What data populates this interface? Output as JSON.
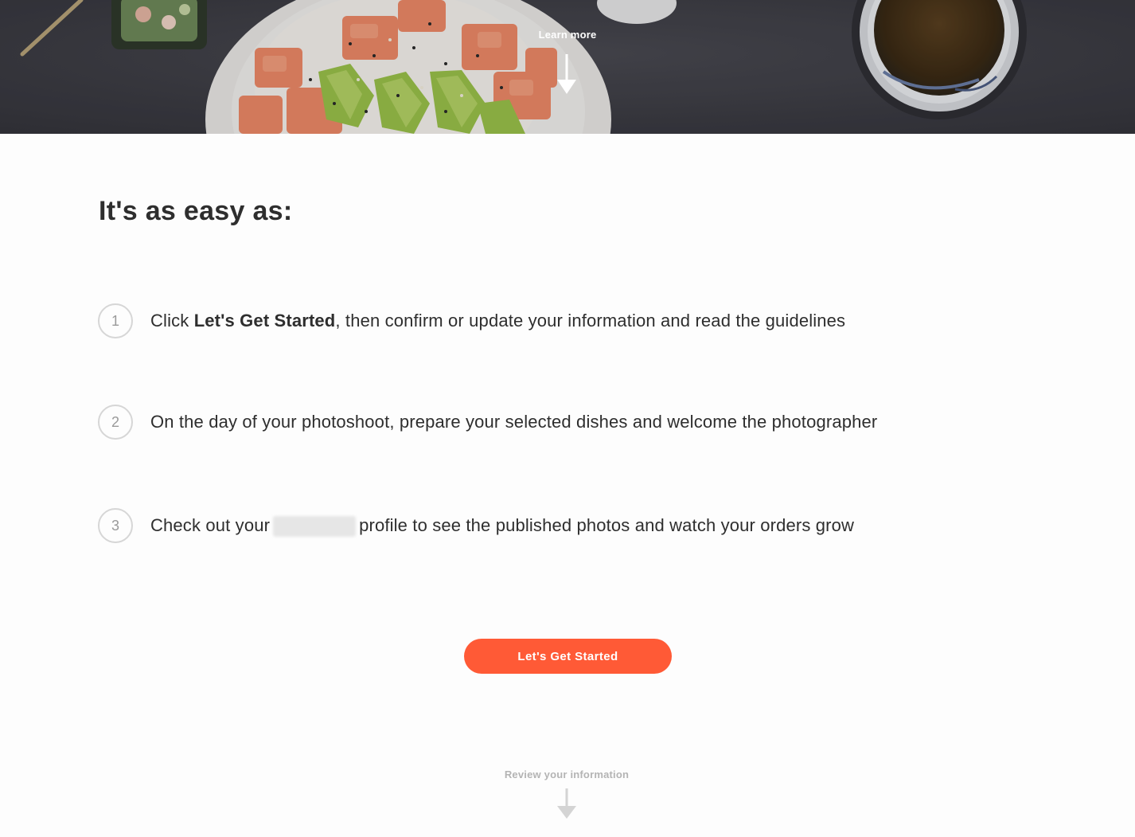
{
  "hero": {
    "learn_more_label": "Learn more"
  },
  "main": {
    "heading": "It's as easy as:",
    "steps": [
      {
        "number": "1",
        "text_before": "Click ",
        "text_bold": "Let's Get Started",
        "text_after": ", then confirm or update your information and read the guidelines"
      },
      {
        "number": "2",
        "text": "On the day of your photoshoot, prepare your selected dishes and welcome the photographer"
      },
      {
        "number": "3",
        "text_before": "Check out your",
        "text_after": "profile to see the published photos and watch your orders grow"
      }
    ],
    "cta_label": "Let's Get Started",
    "review_label": "Review your information"
  },
  "colors": {
    "accent": "#ff5a36",
    "hero_background": "#3f3f46",
    "muted_text": "#b4b4b4"
  }
}
